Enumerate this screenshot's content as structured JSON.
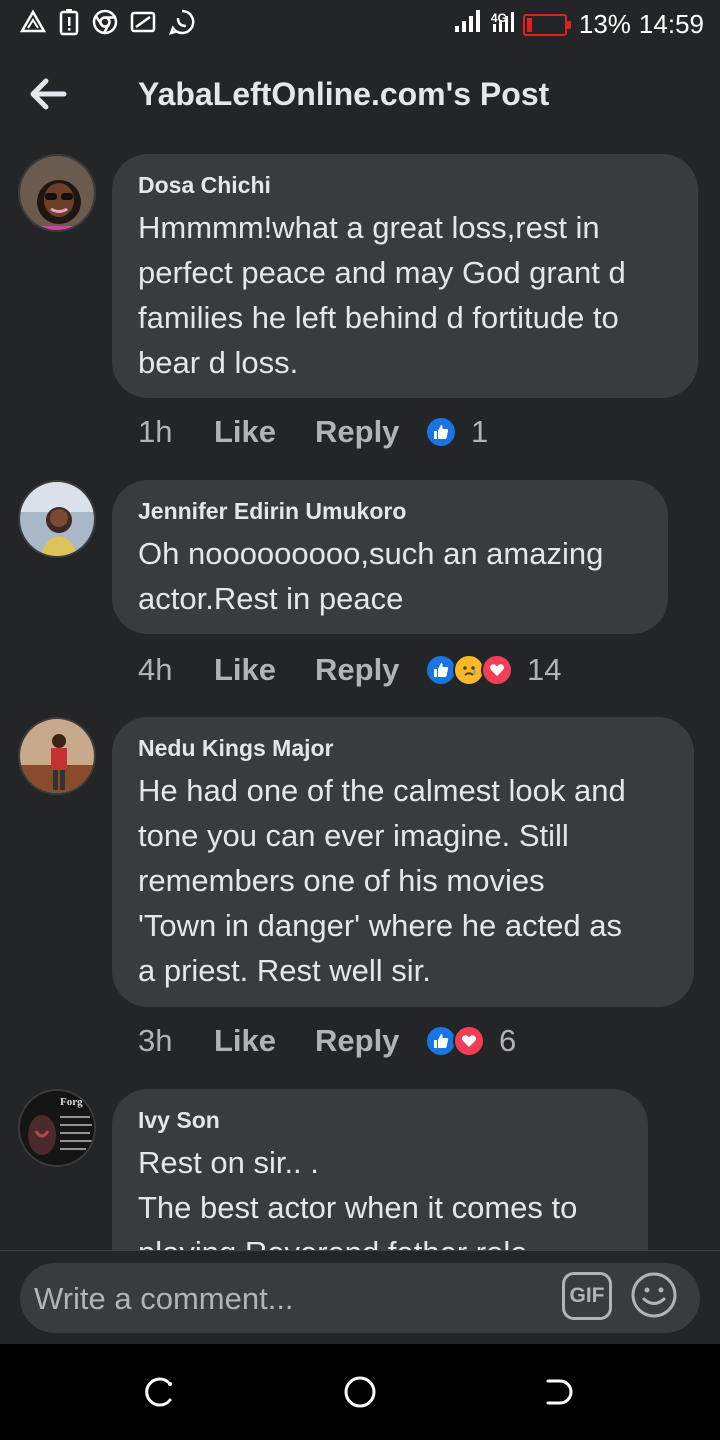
{
  "status_bar": {
    "network": "4G",
    "battery_percent": "13%",
    "time": "14:59"
  },
  "header": {
    "title": "YabaLeftOnline.com's Post"
  },
  "comments": [
    {
      "author": "Dosa Chichi",
      "text": "Hmmmm!what a great loss,rest in\nperfect peace and may God grant d\nfamilies he left behind d fortitude to\nbear d loss.",
      "time": "1h",
      "like_label": "Like",
      "reply_label": "Reply",
      "reactions": [
        "like"
      ],
      "reaction_count": "1"
    },
    {
      "author": "Jennifer Edirin Umukoro",
      "text": "Oh nooooooooo,such an amazing\nactor.Rest in peace",
      "time": "4h",
      "like_label": "Like",
      "reply_label": "Reply",
      "reactions": [
        "like",
        "sad",
        "love"
      ],
      "reaction_count": "14"
    },
    {
      "author": "Nedu Kings Major",
      "text": "He had one of the calmest look and\ntone you can ever imagine. Still\nremembers one of his movies\n'Town in danger' where he acted as\na priest. Rest well sir.",
      "time": "3h",
      "like_label": "Like",
      "reply_label": "Reply",
      "reactions": [
        "like",
        "love"
      ],
      "reaction_count": "6"
    },
    {
      "author": "Ivy Son",
      "text": "Rest on sir.. .\nThe best actor when it comes to\nplaying Reverend father role",
      "avatar_text": "Forg",
      "time": "",
      "reactions": []
    }
  ],
  "composer": {
    "placeholder": "Write a comment...",
    "gif_label": "GIF"
  },
  "colors": {
    "background": "#242526",
    "bubble": "#3a3b3c",
    "text_primary": "#e4e6eb",
    "text_secondary": "#b0b3b8",
    "like_blue": "#1b74e4",
    "love_red": "#f33e58",
    "sad_yellow": "#f7b928",
    "battery_low": "#e02020"
  }
}
